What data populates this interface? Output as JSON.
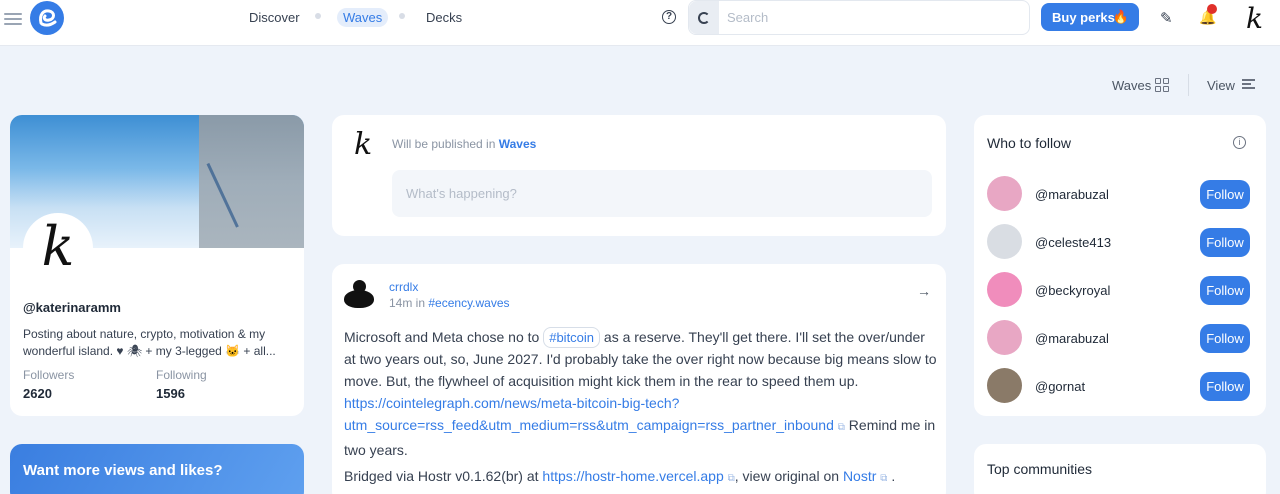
{
  "header": {
    "nav": [
      "Discover",
      "Waves",
      "Decks"
    ],
    "active_nav": "Waves",
    "search_placeholder": "Search",
    "perks_label": "Buy perks",
    "icons": [
      "hamburger-icon",
      "logo-icon",
      "help-icon",
      "search-icon",
      "flame-icon",
      "pencil-icon",
      "bell-icon",
      "avatar"
    ],
    "avatar_letter": "k"
  },
  "toolbar": {
    "waves_label": "Waves",
    "view_label": "View"
  },
  "profile": {
    "avatar_letter": "k",
    "username": "@katerinaramm",
    "bio": "Posting about nature, crypto, motivation & my wonderful island. ♥ 🕷 + my 3-legged 🐱 + all...",
    "followers_label": "Followers",
    "followers": "2620",
    "following_label": "Following",
    "following": "1596"
  },
  "promo": {
    "title": "Want more views and likes?"
  },
  "compose": {
    "avatar_letter": "k",
    "note_prefix": "Will be published in",
    "note_target": "Waves",
    "placeholder": "What's happening?"
  },
  "post": {
    "user": "crrdlx",
    "time": "14m in",
    "community": "#ecency.waves",
    "text_before_tag": "Microsoft and Meta chose no to",
    "tag": "#bitcoin",
    "text_after_tag": "as a reserve. They'll get there. I'll set the over/under at two years out, so, June 2027. I'd probably take the over right now because big means slow to move. But, the flywheel of acquisition might kick them in the rear to speed them up.",
    "link": "https://cointelegraph.com/news/meta-bitcoin-big-tech?utm_source=rss_feed&utm_medium=rss&utm_campaign=rss_partner_inbound",
    "link_line1": "https://cointelegraph.com/news/meta-bitcoin-big-tech?",
    "link_line2": "utm_source=rss_feed&utm_medium=rss&utm_campaign=rss_partner_inbound",
    "after_link": "Remind me in two years.",
    "bridged_prefix": "Bridged via Hostr v0.1.62(br) at",
    "bridged_link": "https://hostr-home.vercel.app",
    "bridged_middle": ", view original on",
    "bridged_nostr": "Nostr",
    "bridged_end": "."
  },
  "who_to_follow": {
    "title": "Who to follow",
    "button_label": "Follow",
    "users": [
      {
        "name": "@marabuzal",
        "color": "#e8a7c4"
      },
      {
        "name": "@celeste413",
        "color": "#d9dde3"
      },
      {
        "name": "@beckyroyal",
        "color": "#f08dbc"
      },
      {
        "name": "@marabuzal",
        "color": "#e8a7c4"
      },
      {
        "name": "@gornat",
        "color": "#8a7a68"
      }
    ]
  },
  "communities": {
    "title": "Top communities"
  },
  "colors": {
    "accent": "#357ce6",
    "notification": "#e0302a",
    "background": "#eef3fa"
  }
}
